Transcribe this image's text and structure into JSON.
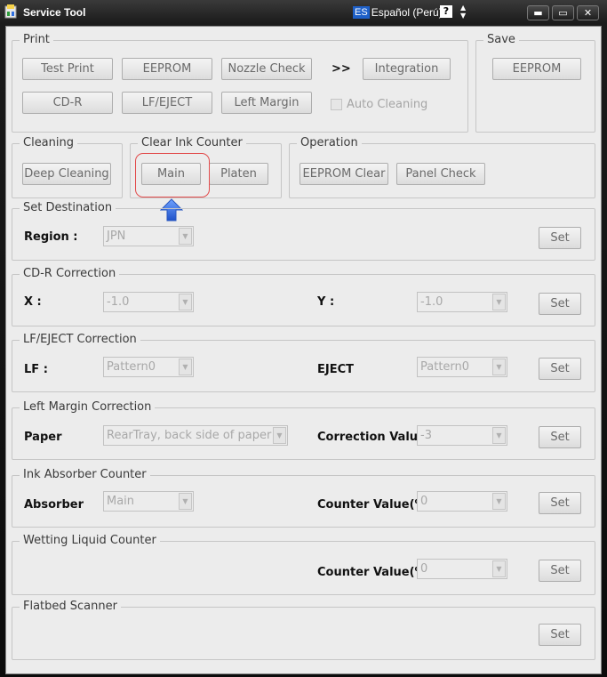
{
  "window": {
    "title": "Service Tool",
    "language_code": "ES",
    "language_name": "Español (Perú)",
    "help_label": "?",
    "minimize_label": "▬",
    "maximize_label": "▭",
    "close_label": "✕"
  },
  "print": {
    "title": "Print",
    "test_print": "Test Print",
    "eeprom": "EEPROM",
    "nozzle_check": "Nozzle Check",
    "arrow": ">>",
    "integration": "Integration",
    "cdr": "CD-R",
    "lf_eject": "LF/EJECT",
    "left_margin": "Left Margin",
    "auto_cleaning": "Auto Cleaning"
  },
  "save": {
    "title": "Save",
    "eeprom": "EEPROM"
  },
  "cleaning": {
    "title": "Cleaning",
    "deep_cleaning": "Deep Cleaning"
  },
  "clear_ink": {
    "title": "Clear Ink Counter",
    "main": "Main",
    "platen": "Platen"
  },
  "operation": {
    "title": "Operation",
    "eeprom_clear": "EEPROM Clear",
    "panel_check": "Panel Check"
  },
  "set_destination": {
    "title": "Set Destination",
    "region_label": "Region :",
    "region_value": "JPN",
    "set": "Set"
  },
  "cdr_correction": {
    "title": "CD-R Correction",
    "x_label": "X :",
    "x_value": "-1.0",
    "y_label": "Y :",
    "y_value": "-1.0",
    "set": "Set"
  },
  "lf_eject_correction": {
    "title": "LF/EJECT Correction",
    "lf_label": "LF :",
    "lf_value": "Pattern0",
    "eject_label": "EJECT",
    "eject_value": "Pattern0",
    "set": "Set"
  },
  "left_margin_correction": {
    "title": "Left Margin Correction",
    "paper_label": "Paper",
    "paper_value": "RearTray, back side of paper",
    "correction_label": "Correction Value",
    "correction_value": "-3",
    "set": "Set"
  },
  "ink_absorber": {
    "title": "Ink Absorber Counter",
    "absorber_label": "Absorber",
    "absorber_value": "Main",
    "counter_label": "Counter Value(%)",
    "counter_value": "0",
    "set": "Set"
  },
  "wetting_liquid": {
    "title": "Wetting Liquid Counter",
    "counter_label": "Counter Value(%)",
    "counter_value": "0",
    "set": "Set"
  },
  "flatbed_scanner": {
    "title": "Flatbed Scanner",
    "set": "Set"
  },
  "colors": {
    "highlight": "#e24b4b",
    "arrow": "#2f6fe0",
    "title_bar": "#1b1b1b",
    "dialog_bg": "#ececec"
  }
}
